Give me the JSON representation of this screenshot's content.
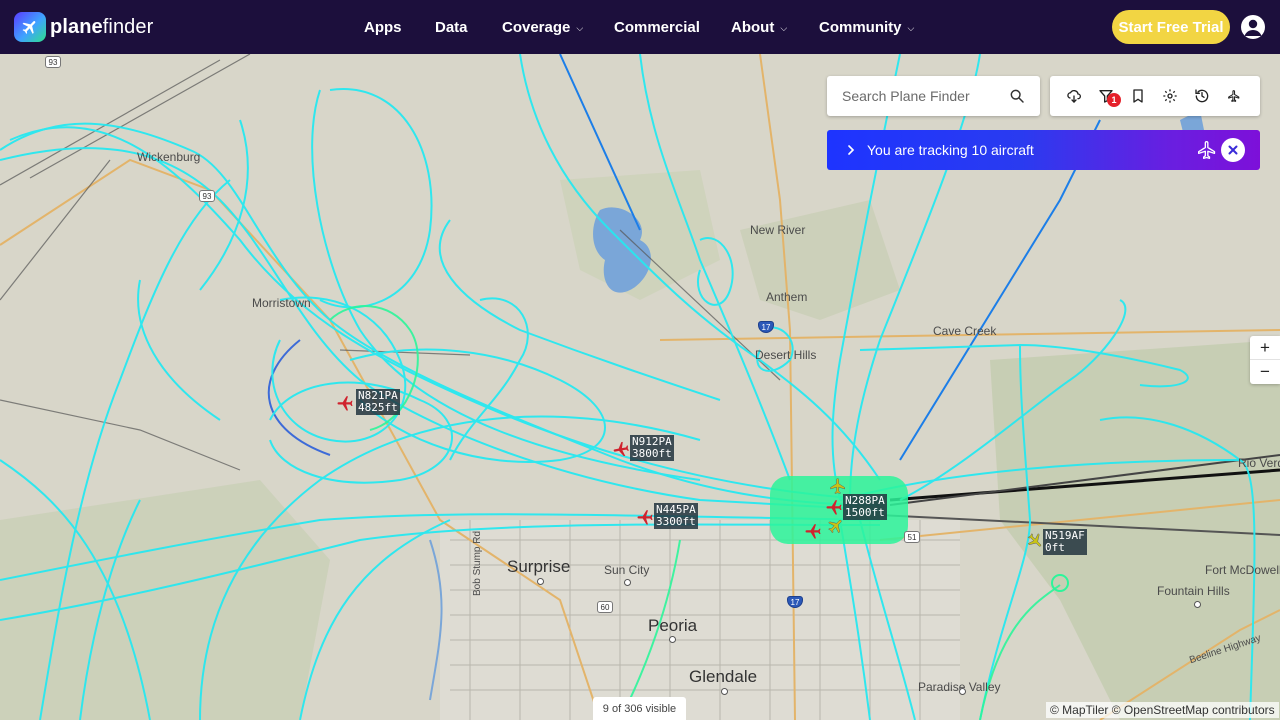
{
  "brand": {
    "name_bold": "plane",
    "name_rest": "finder"
  },
  "nav": {
    "items": [
      {
        "label": "Apps",
        "has_menu": false
      },
      {
        "label": "Data",
        "has_menu": false
      },
      {
        "label": "Coverage",
        "has_menu": true
      },
      {
        "label": "Commercial",
        "has_menu": false
      },
      {
        "label": "About",
        "has_menu": true
      },
      {
        "label": "Community",
        "has_menu": true
      }
    ],
    "cta_label": "Start Free Trial"
  },
  "search": {
    "placeholder": "Search Plane Finder"
  },
  "toolbar": {
    "icons": [
      "weather-icon",
      "filter-icon",
      "bookmark-icon",
      "settings-icon",
      "playback-icon",
      "airport-icon"
    ],
    "filter_badge": "1"
  },
  "tracking": {
    "text": "You are tracking 10 aircraft"
  },
  "zoom": {
    "in_label": "+",
    "out_label": "−"
  },
  "map": {
    "places": [
      {
        "name": "Wickenburg",
        "type": "town"
      },
      {
        "name": "New River",
        "type": "town"
      },
      {
        "name": "Anthem",
        "type": "town"
      },
      {
        "name": "Cave Creek",
        "type": "town"
      },
      {
        "name": "Desert Hills",
        "type": "town"
      },
      {
        "name": "Morristown",
        "type": "town"
      },
      {
        "name": "Surprise",
        "type": "city"
      },
      {
        "name": "Sun City",
        "type": "town"
      },
      {
        "name": "Peoria",
        "type": "city"
      },
      {
        "name": "Glendale",
        "type": "city"
      },
      {
        "name": "Paradise Valley",
        "type": "town"
      },
      {
        "name": "Fountain Hills",
        "type": "town"
      },
      {
        "name": "Fort McDowell",
        "type": "town"
      },
      {
        "name": "Rio Verde",
        "type": "town"
      },
      {
        "name": "Bob Stump Rd",
        "type": "road"
      },
      {
        "name": "Beeline Highway",
        "type": "road"
      }
    ],
    "shields": [
      "93",
      "93",
      "17",
      "51",
      "60",
      "17"
    ],
    "aircraft": [
      {
        "callsign": "N821PA",
        "altitude": "4825ft",
        "color": "#d0232e"
      },
      {
        "callsign": "N912PA",
        "altitude": "3800ft",
        "color": "#d0232e"
      },
      {
        "callsign": "N445PA",
        "altitude": "3300ft",
        "color": "#d0232e"
      },
      {
        "callsign": "N288PA",
        "altitude": "1500ft",
        "color": "#d0232e"
      },
      {
        "callsign": "N519AF",
        "altitude": "0ft",
        "color": "#c9c414"
      }
    ],
    "track_color": "#27e8f0",
    "track_highlight_color": "#2cf59a"
  },
  "footer": {
    "visible_count": "9 of 306 visible",
    "attribution": "© MapTiler © OpenStreetMap contributors"
  }
}
